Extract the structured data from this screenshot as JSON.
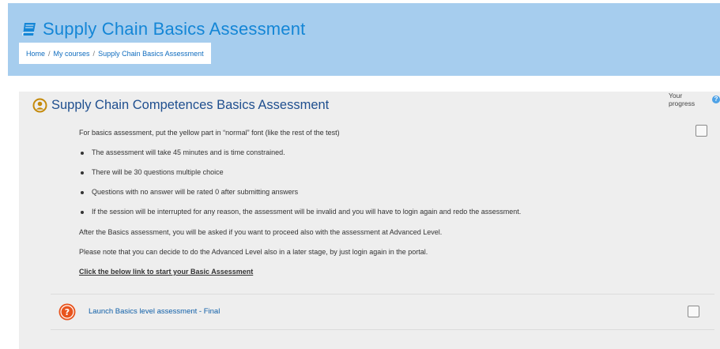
{
  "header": {
    "title": "Supply Chain Basics Assessment",
    "breadcrumb": [
      "Home",
      "My courses",
      "Supply Chain Basics Assessment"
    ],
    "breadcrumb_separator": "/"
  },
  "section": {
    "title": "Supply Chain Competences Basics Assessment",
    "progress_label": "Your progress",
    "help_glyph": "?"
  },
  "summary": {
    "intro": "For basics assessment, put the yellow part in “normal” font (like the rest of the test)",
    "bullets": [
      "The assessment will take 45 minutes and is time constrained.",
      "There will be 30 questions multiple choice",
      "Questions with no answer will be rated 0 after submitting answers",
      "If the session will be interrupted for any reason, the assessment will be invalid and you will have to login again and redo the assessment."
    ],
    "after_text": "After the Basics assessment, you will be asked if you want to proceed also with the assessment at Advanced Level.",
    "note_text": "Please note that you can decide to do the Advanced Level also in a later stage, by just login again in the portal.",
    "start_link": "Click the below link to start your Basic Assessment"
  },
  "activity": {
    "label": "Launch Basics level assessment - Final",
    "icon": "quiz-help-icon"
  },
  "colors": {
    "hero_bg": "#a6cdee",
    "title_blue": "#1486d6",
    "section_title": "#1f4f8f",
    "link": "#0f5fa8",
    "quiz_icon": "#e8541e",
    "user_icon": "#c58a0b"
  }
}
